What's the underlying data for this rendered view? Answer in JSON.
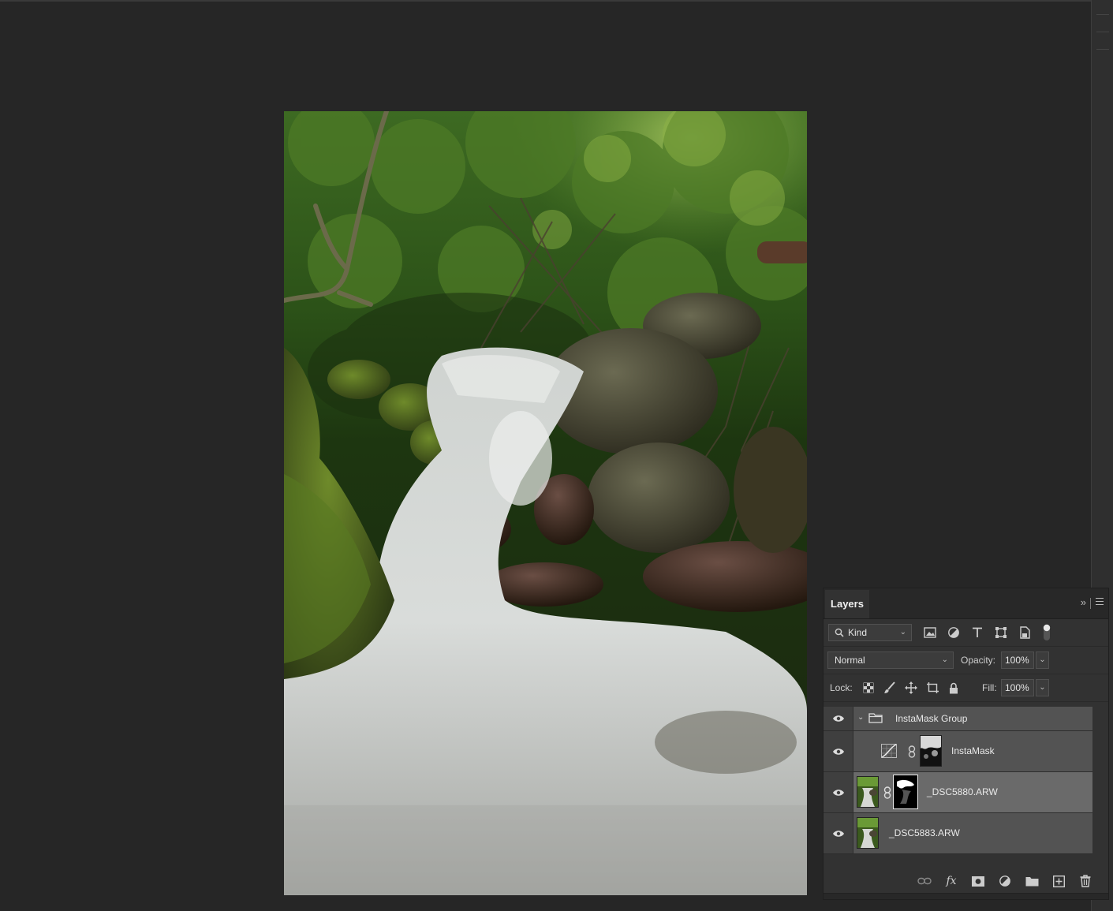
{
  "layers_panel": {
    "tab_label": "Layers",
    "filter_kind": "Kind",
    "blend_mode": "Normal",
    "opacity_label": "Opacity:",
    "opacity_value": "100%",
    "lock_label": "Lock:",
    "fill_label": "Fill:",
    "fill_value": "100%",
    "layers": [
      {
        "name": "InstaMask Group",
        "type": "group",
        "visible": true,
        "expanded": true
      },
      {
        "name": "InstaMask",
        "type": "adjustment",
        "visible": true
      },
      {
        "name": "_DSC5880.ARW",
        "type": "pixel-with-mask",
        "visible": true,
        "selected": true
      },
      {
        "name": "_DSC5883.ARW",
        "type": "pixel",
        "visible": true
      }
    ]
  },
  "icons": {
    "filter": [
      "image-filter-icon",
      "adjustment-filter-icon",
      "type-filter-icon",
      "shape-filter-icon",
      "smart-object-filter-icon"
    ],
    "lock": [
      "lock-transparent-icon",
      "lock-paint-icon",
      "lock-position-icon",
      "lock-artboard-icon",
      "lock-all-icon"
    ],
    "footer": [
      "link-layers-icon",
      "fx-icon",
      "add-mask-icon",
      "new-adjustment-icon",
      "new-group-icon",
      "new-layer-icon",
      "delete-layer-icon"
    ]
  },
  "colors": {
    "panel_bg": "#323232",
    "selected_row": "#6a6a6a",
    "app_bg": "#262626"
  }
}
